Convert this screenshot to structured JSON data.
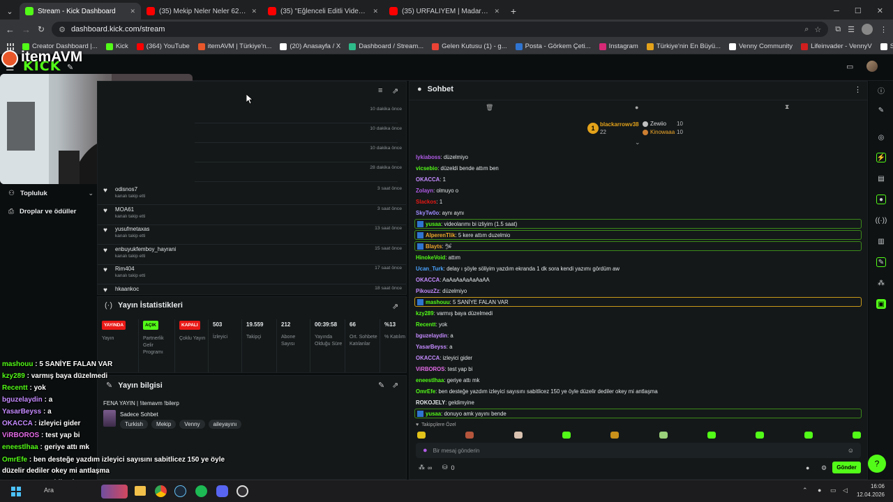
{
  "browser": {
    "tabs": [
      {
        "title": "Stream - Kick Dashboard",
        "color": "#53fc18"
      },
      {
        "title": "(35) Mekip Neler Neler 62.Bölü",
        "color": "#ff0000"
      },
      {
        "title": "(35) \"Eğlenceli Editli Video\" Kic",
        "color": "#ff0000"
      },
      {
        "title": "(35) URFALİYEM | Madara Oldu",
        "color": "#ff0000"
      }
    ],
    "url": "dashboard.kick.com/stream",
    "bookmarks": [
      {
        "label": "Creator Dashboard |...",
        "color": "#53fc18"
      },
      {
        "label": "Kick",
        "color": "#53fc18"
      },
      {
        "label": "(364) YouTube",
        "color": "#ff0000"
      },
      {
        "label": "itemAVM | Türkiye'n...",
        "color": "#e8572a"
      },
      {
        "label": "(20) Anasayfa / X",
        "color": "#ffffff"
      },
      {
        "label": "Dashboard / Stream...",
        "color": "#2dbb8a"
      },
      {
        "label": "Gelen Kutusu (1) - g...",
        "color": "#ea4335"
      },
      {
        "label": "Posta - Görkem Çeti...",
        "color": "#2f74d0"
      },
      {
        "label": "Instagram",
        "color": "#d62976"
      },
      {
        "label": "Türkiye'nin En Büyü...",
        "color": "#e3a21a"
      },
      {
        "label": "Venny Community",
        "color": "#ffffff"
      },
      {
        "label": "Lifeinvader - VennyV",
        "color": "#d11f1f"
      },
      {
        "label": "Storage | Fivemanage",
        "color": "#ffffff"
      }
    ]
  },
  "header": {
    "logo": "KICK",
    "overlay_brand": "itemAVM"
  },
  "left_nav": {
    "items": [
      {
        "label": "Topluluk"
      },
      {
        "label": "Droplar ve ödüller"
      }
    ]
  },
  "activity": {
    "times_top": [
      "10 dakika önce",
      "10 dakika önce",
      "10 dakika önce",
      "28 dakika önce"
    ],
    "follows": [
      {
        "name": "odisnos7",
        "action": "kanalı takip etti",
        "time": "3 saat önce"
      },
      {
        "name": "MOA61",
        "action": "kanalı takip etti",
        "time": "3 saat önce"
      },
      {
        "name": "yusufmetaxas",
        "action": "kanalı takip etti",
        "time": "13 saat önce"
      },
      {
        "name": "enbuyukfemboy_hayrani",
        "action": "kanalı takip etti",
        "time": "15 saat önce"
      },
      {
        "name": "Rim404",
        "action": "kanalı takip etti",
        "time": "17 saat önce"
      },
      {
        "name": "hkaankoc",
        "action": "",
        "time": "18 saat önce"
      }
    ]
  },
  "stats": {
    "title": "Yayın İstatistikleri",
    "items": [
      {
        "value": "YAYINDA",
        "label": "Yayın",
        "badge": true,
        "color": "#e91916"
      },
      {
        "value": "AÇIK",
        "label": "Partnerlik Gelir Programı",
        "badge": true,
        "color": "#53fc18"
      },
      {
        "value": "KAPALI",
        "label": "Çoklu Yayın",
        "badge": true,
        "color": "#e91916"
      },
      {
        "value": "503",
        "label": "İzleyici",
        "badge": false
      },
      {
        "value": "19.559",
        "label": "Takipçi",
        "badge": false
      },
      {
        "value": "212",
        "label": "Abone Sayısı",
        "badge": false
      },
      {
        "value": "00:39:58",
        "label": "Yayında Olduğu Süre",
        "badge": false
      },
      {
        "value": "66",
        "label": "Ort. Sohbete Katılanlar",
        "badge": false
      },
      {
        "value": "%13",
        "label": "% Katılım",
        "badge": false
      }
    ]
  },
  "stream_info": {
    "title": "Yayın bilgisi",
    "stream_title": "FENA YAYIN | !itemavm !bilerp",
    "category": "Sadece Sohbet",
    "tags": [
      "Turkish",
      "Mekip",
      "Venny",
      "aileyayını"
    ]
  },
  "chat": {
    "title": "Sohbet",
    "leaderboard": {
      "first": {
        "name": "blackarrowv38",
        "count": "22"
      },
      "second": {
        "name": "Zewiio",
        "count": "10"
      },
      "third": {
        "name": "Kinowaaa",
        "count": "10"
      }
    },
    "messages": [
      {
        "user": "lykiaboss",
        "color": "#b25ce8",
        "text": "düzelmiyo",
        "hl": false
      },
      {
        "user": "vicsebio",
        "color": "#53fc18",
        "text": "düzeldi bende attım ben",
        "hl": false
      },
      {
        "user": "OKACCA",
        "color": "#c58bff",
        "text": "1",
        "hl": false
      },
      {
        "user": "Zolayn",
        "color": "#b25ce8",
        "text": "olmuyo o",
        "hl": false
      },
      {
        "user": "Slackos",
        "color": "#e91916",
        "text": "1",
        "hl": false
      },
      {
        "user": "SkyTw0o",
        "color": "#9e8cff",
        "text": "aynı aynı",
        "hl": false
      },
      {
        "user": "yusaa",
        "color": "#53fc18",
        "text": "videolarımı bi izliyim (1.5 saat)",
        "hl": true
      },
      {
        "user": "AlperenTlik",
        "color": "#f0a82a",
        "text": "5 kere attım duzelmio",
        "hl": true
      },
      {
        "user": "Blayts",
        "color": "#f0a82a",
        "text": "🛩",
        "hl": true
      },
      {
        "user": "HinokeVoid",
        "color": "#53fc18",
        "text": "attım",
        "hl": false
      },
      {
        "user": "Ucan_Turk",
        "color": "#4aa3ff",
        "text": "delay ı şöyle söliyim yazdım ekranda 1 dk sora kendi yazımı gördüm aw",
        "hl": false
      },
      {
        "user": "OKACCA",
        "color": "#c58bff",
        "text": "AaAaAaAaAaAaAA",
        "hl": false
      },
      {
        "user": "PikouzZz",
        "color": "#c58bff",
        "text": "düzelmiyo",
        "hl": false
      },
      {
        "user": "mashouu",
        "color": "#53fc18",
        "text": "5 SANİYE FALAN VAR",
        "hl": true
      },
      {
        "user": "kzy289",
        "color": "#53fc18",
        "text": "varmış baya düzelmedi",
        "hl": false
      },
      {
        "user": "Recentt",
        "color": "#53fc18",
        "text": "yok",
        "hl": false
      },
      {
        "user": "bguzelaydin",
        "color": "#c58bff",
        "text": "a",
        "hl": false
      },
      {
        "user": "YasarBeyss",
        "color": "#c58bff",
        "text": "a",
        "hl": false
      },
      {
        "user": "OKACCA",
        "color": "#c58bff",
        "text": "izleyici gider",
        "hl": false
      },
      {
        "user": "ViRBOROS",
        "color": "#e56ce8",
        "text": "test yap bi",
        "hl": false
      },
      {
        "user": "eneestlhaa",
        "color": "#53fc18",
        "text": "geriye attı mk",
        "hl": false
      },
      {
        "user": "OmrEfe",
        "color": "#53fc18",
        "text": "ben desteğe yazdım izleyici sayısını sabitlicez 150 ye öyle düzelir dediler okey mi antlaşma",
        "hl": false
      },
      {
        "user": "ROKOJELY",
        "color": "#e6e8ea",
        "text": "geldimyine",
        "hl": false
      },
      {
        "user": "yusaa",
        "color": "#53fc18",
        "text": "donuyo amk yayını bende",
        "hl": true
      }
    ],
    "special_label": "Takipçilere Özel",
    "input_placeholder": "Bir mesaj gönderin",
    "send_label": "Gönder",
    "infinity_label": "∞",
    "cup_count": "0"
  },
  "overlay_chat": [
    {
      "user": "mashouu",
      "color": "#53fc18",
      "text": "5 SANİYE FALAN VAR"
    },
    {
      "user": "kzy289",
      "color": "#53fc18",
      "text": "varmış baya düzelmedi"
    },
    {
      "user": "Recentt",
      "color": "#53fc18",
      "text": "yok"
    },
    {
      "user": "bguzelaydin",
      "color": "#c58bff",
      "text": "a"
    },
    {
      "user": "YasarBeyss",
      "color": "#c58bff",
      "text": "a"
    },
    {
      "user": "OKACCA",
      "color": "#c58bff",
      "text": "izleyici gider"
    },
    {
      "user": "ViRBOROS",
      "color": "#e56ce8",
      "text": "test yap bi"
    },
    {
      "user": "eneestlhaa",
      "color": "#53fc18",
      "text": "geriye attı mk"
    },
    {
      "user": "OmrEfe",
      "color": "#53fc18",
      "text": "ben desteğe yazdım izleyici sayısını sabitlicez 150 ye öyle"
    },
    {
      "user": "",
      "color": "#53fc18",
      "text": "düzelir dediler okey mi antlaşma"
    },
    {
      "user": "ROKOJELY",
      "color": "#c58bff",
      "text": "geldimyine"
    },
    {
      "user": "yusaa",
      "color": "#53fc18",
      "text": "donuyo amk yayını bende"
    }
  ],
  "taskbar": {
    "search_label": "Ara",
    "time": "16:06",
    "date": "12.04.2026"
  }
}
